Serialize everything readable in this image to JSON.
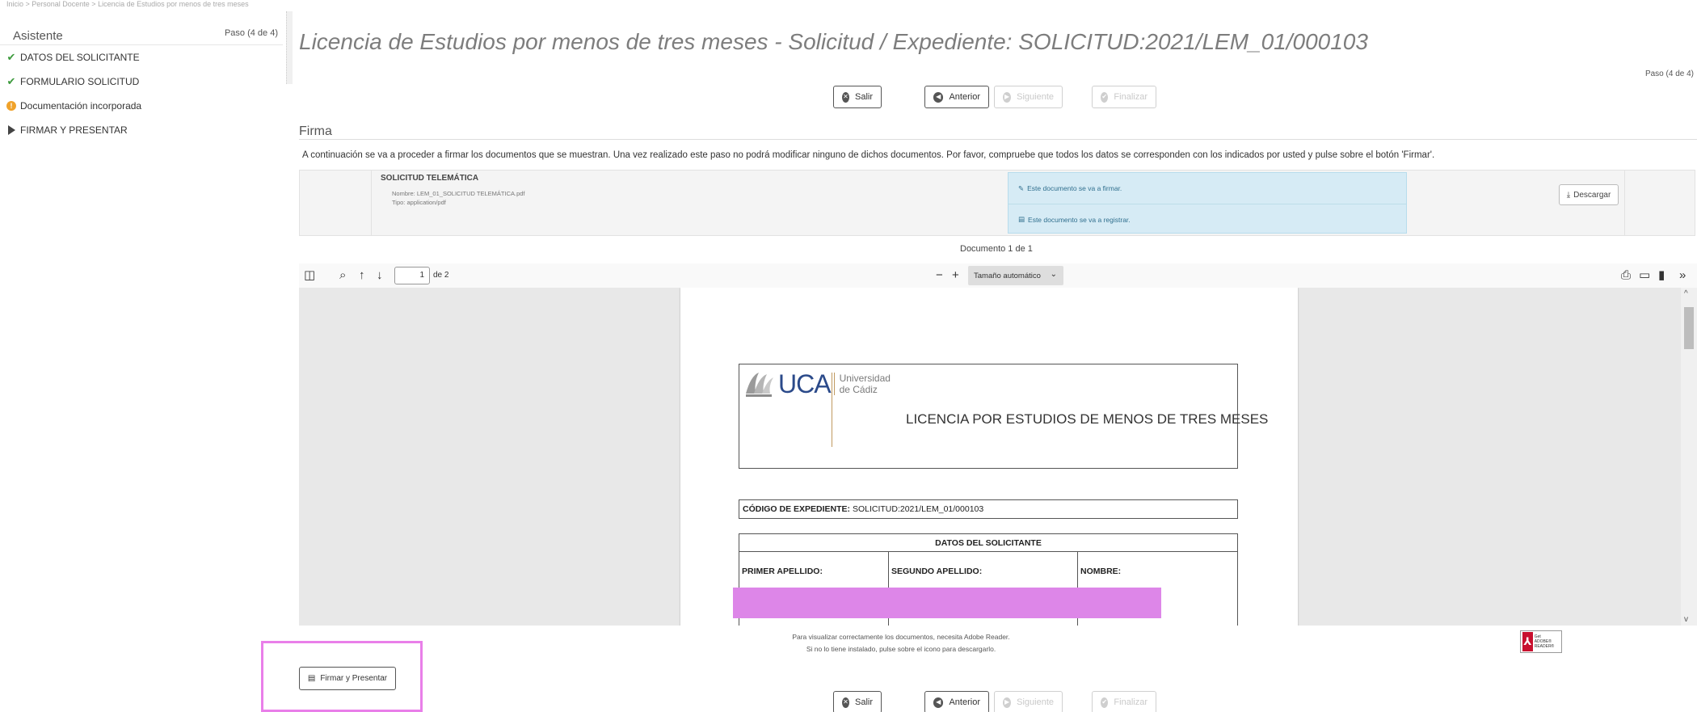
{
  "breadcrumb": "Inicio > Personal Docente > Licencia de Estudios por menos de tres meses",
  "sidebar": {
    "title": "Asistente",
    "step": "Paso (4 de 4)",
    "items": [
      {
        "label": "DATOS DEL SOLICITANTE",
        "status": "done"
      },
      {
        "label": "FORMULARIO SOLICITUD",
        "status": "done"
      },
      {
        "label": "Documentación incorporada",
        "status": "warning"
      },
      {
        "label": "FIRMAR Y PRESENTAR",
        "status": "current"
      }
    ]
  },
  "main": {
    "title": "Licencia de Estudios por menos de tres meses - Solicitud / Expediente: SOLICITUD:2021/LEM_01/000103",
    "step": "Paso (4 de 4)"
  },
  "nav_buttons": {
    "salir": "Salir",
    "anterior": "Anterior",
    "siguiente": "Siguiente",
    "finalizar": "Finalizar"
  },
  "firma": {
    "section_title": "Firma",
    "notice": "A continuación se va a proceder a firmar los documentos que se muestran. Una vez realizado este paso no podrá modificar ninguno de dichos documentos. Por favor, compruebe que todos los datos se corresponden con los indicados por usted y pulse sobre el botón 'Firmar'.",
    "document": {
      "name": "SOLICITUD TELEMÁTICA",
      "filename": "Nombre: LEM_01_SOLICITUD TELEMÁTICA.pdf",
      "type": "Tipo: application/pdf",
      "sign_note": "Este documento se va a firmar.",
      "register_note": "Este documento se va a registrar.",
      "download_label": "Descargar"
    },
    "doc_count": "Documento 1 de 1"
  },
  "pdf_toolbar": {
    "page_value": "1",
    "page_total": "de 2",
    "zoom": "Tamaño automático"
  },
  "pdf_page": {
    "logo_text": "UCA",
    "logo_uni_line1": "Universidad",
    "logo_uni_line2": "de Cádiz",
    "header_title": "LICENCIA POR ESTUDIOS DE MENOS DE TRES MESES",
    "code_label": "CÓDIGO DE EXPEDIENTE:",
    "code_value": "SOLICITUD:2021/LEM_01/000103",
    "datos_header": "DATOS DEL SOLICITANTE",
    "primer_apellido": "PRIMER APELLIDO:",
    "segundo_apellido": "SEGUNDO APELLIDO:",
    "nombre": "NOMBRE:"
  },
  "reader_notice": {
    "line1": "Para visualizar correctamente los documentos, necesita Adobe Reader.",
    "line2": "Si no lo tiene instalado, pulse sobre el icono para descargarlo.",
    "badge_line1": "Get",
    "badge_line2": "ADOBE® READER®"
  },
  "firmar_presentar": "Firmar y Presentar",
  "colors": {
    "highlight": "#e97fe9",
    "redaction": "#dd86e8",
    "info_bg": "#d6ebf5",
    "success": "#3c9a3c",
    "warning": "#f0a22a"
  }
}
